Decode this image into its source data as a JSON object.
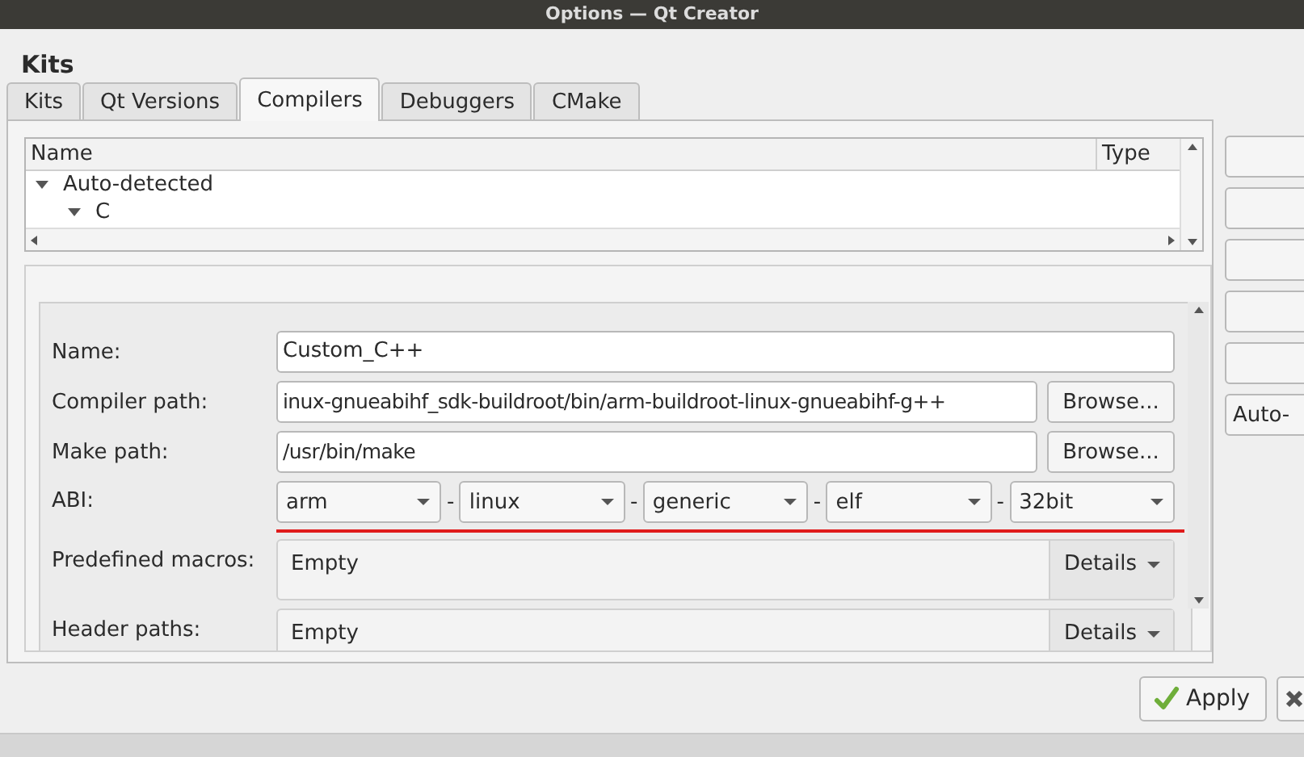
{
  "window": {
    "title": "Options — Qt Creator"
  },
  "heading": "Kits",
  "tabs": [
    {
      "label": "Kits",
      "selected": false
    },
    {
      "label": "Qt Versions",
      "selected": false
    },
    {
      "label": "Compilers",
      "selected": true
    },
    {
      "label": "Debuggers",
      "selected": false
    },
    {
      "label": "CMake",
      "selected": false
    }
  ],
  "tree": {
    "columns": [
      "Name",
      "Type"
    ],
    "items": [
      {
        "label": "Auto-detected",
        "expanded": true,
        "children": [
          {
            "label": "C",
            "expanded": true
          }
        ]
      }
    ]
  },
  "side_button": "Auto-",
  "form": {
    "rows": [
      {
        "kind": "text",
        "label": "Name:",
        "value": "Custom_C++"
      },
      {
        "kind": "path",
        "label": "Compiler path:",
        "value": "inux-gnueabihf_sdk-buildroot/bin/arm-buildroot-linux-gnueabihf-g++",
        "button": "Browse..."
      },
      {
        "kind": "path",
        "label": "Make path:",
        "value": "/usr/bin/make",
        "button": "Browse..."
      },
      {
        "kind": "abi",
        "label": "ABI:",
        "invalid": true,
        "parts": [
          {
            "value": "arm"
          },
          {
            "separator": "-",
            "value": "linux"
          },
          {
            "separator": "-",
            "value": "generic"
          },
          {
            "separator": "-",
            "value": "elf"
          },
          {
            "separator": "-",
            "value": "32bit"
          }
        ]
      },
      {
        "kind": "details",
        "label": "Predefined macros:",
        "value": "Empty",
        "button": "Details"
      },
      {
        "kind": "details",
        "label": "Header paths:",
        "value": "Empty",
        "button": "Details"
      }
    ]
  },
  "apply_button": "Apply"
}
